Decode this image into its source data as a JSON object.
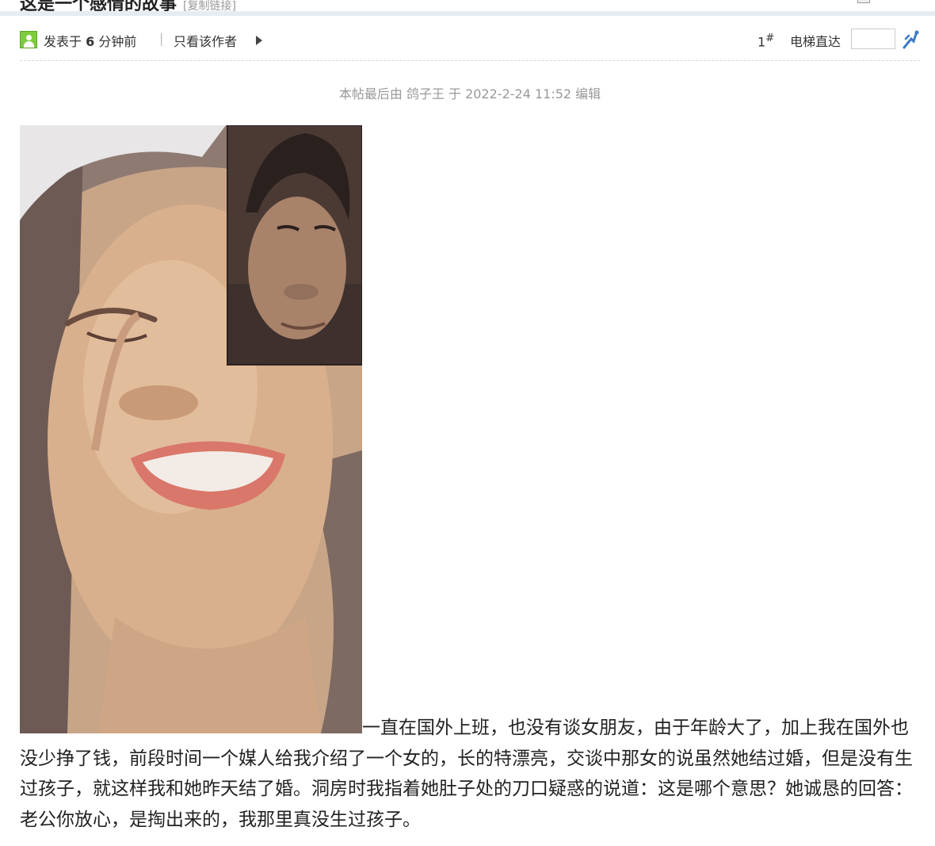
{
  "thread": {
    "title": "这是一个感情的故事",
    "title_tag": "[复制链接]"
  },
  "post": {
    "posted_prefix": "发表于",
    "posted_minutes": "6",
    "posted_suffix": "分钟前",
    "separator": "|",
    "only_author_label": "只看该作者",
    "floor_number": "1",
    "floor_mark": "#",
    "elevator_label": "电梯直达",
    "elevator_value": "",
    "edit_note": "本帖最后由 鸽子王 于 2022-2-24 11:52 编辑",
    "body": "一直在国外上班，也没有谈女朋友，由于年龄大了，加上我在国外也没少挣了钱，前段时间一个媒人给我介绍了一个女的，长的特漂亮，交谈中那女的说虽然她结过婚，但是没有生过孩子，就这样我和她昨天结了婚。洞房时我指着她肚子处的刀口疑惑的说道：这是哪个意思？她诚恳的回答：老公你放心，是掏出来的，我那里真没生过孩子。"
  },
  "icons": {
    "avatar": "avatar-icon",
    "triangle": "triangle-right-icon",
    "elevator": "elevator-go-icon"
  },
  "colors": {
    "avatar_green": "#7ecb3f",
    "divider": "#e5edf2",
    "elevator_blue": "#3b7ac4",
    "muted_text": "#999999"
  }
}
